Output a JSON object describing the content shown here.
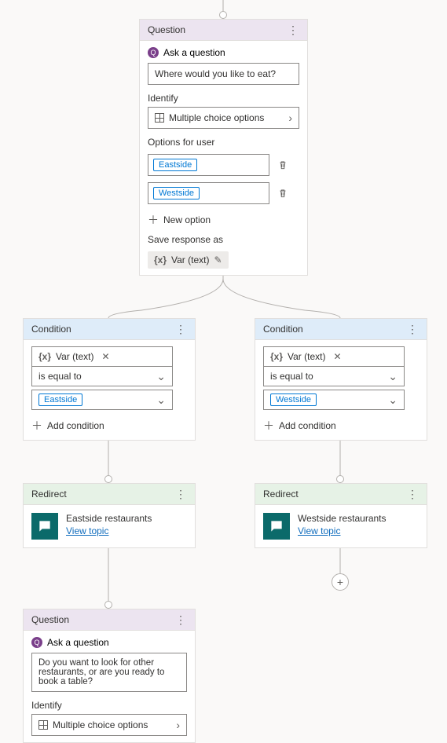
{
  "question1": {
    "headerTitle": "Question",
    "askLabel": "Ask a question",
    "prompt": "Where would you like to eat?",
    "identifyLabel": "Identify",
    "identifyValue": "Multiple choice options",
    "optionsLabel": "Options for user",
    "option1": "Eastside",
    "option2": "Westside",
    "newOption": "New option",
    "saveAsLabel": "Save response as",
    "varSym": "{x}",
    "varName": "Var (text)"
  },
  "condition1": {
    "headerTitle": "Condition",
    "varSym": "{x}",
    "varName": "Var (text)",
    "operator": "is equal to",
    "value": "Eastside",
    "addCondition": "Add condition"
  },
  "condition2": {
    "headerTitle": "Condition",
    "varSym": "{x}",
    "varName": "Var (text)",
    "operator": "is equal to",
    "value": "Westside",
    "addCondition": "Add condition"
  },
  "redirect1": {
    "headerTitle": "Redirect",
    "title": "Eastside restaurants",
    "link": "View topic"
  },
  "redirect2": {
    "headerTitle": "Redirect",
    "title": "Westside restaurants",
    "link": "View topic"
  },
  "question2": {
    "headerTitle": "Question",
    "askLabel": "Ask a question",
    "prompt": "Do you want to look for other restaurants, or are you ready to book a table?",
    "identifyLabel": "Identify",
    "identifyValue": "Multiple choice options"
  }
}
